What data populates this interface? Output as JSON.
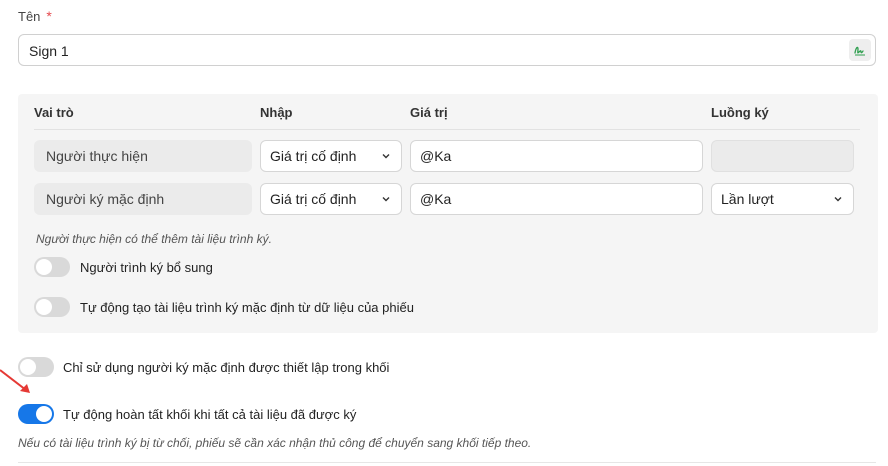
{
  "name_field": {
    "label": "Tên",
    "required_mark": "*",
    "value": "Sign 1"
  },
  "table": {
    "headers": {
      "role": "Vai trò",
      "input": "Nhập",
      "value": "Giá trị",
      "flow": "Luồng ký"
    },
    "rows": [
      {
        "role": "Người thực hiện",
        "input": "Giá trị cố định",
        "value": "@Ka",
        "flow": ""
      },
      {
        "role": "Người ký mặc định",
        "input": "Giá trị cố định",
        "value": "@Ka",
        "flow": "Lần lượt"
      }
    ],
    "note": "Người thực hiện có thể thêm tài liệu trình ký."
  },
  "toggles": {
    "additional_submitter": {
      "label": "Người trình ký bổ sung",
      "on": false
    },
    "auto_create_docs": {
      "label": "Tự động tạo tài liệu trình ký mặc định từ dữ liệu của phiếu",
      "on": false
    },
    "only_default_signers": {
      "label": "Chỉ sử dụng người ký mặc định được thiết lập trong khối",
      "on": false
    },
    "auto_complete_block": {
      "label": "Tự động hoàn tất khối khi tất cả tài liệu đã được ký",
      "on": true
    }
  },
  "footer_note": "Nếu có tài liệu trình ký bị từ chối, phiếu sẽ cần xác nhận thủ công để chuyển sang khối tiếp theo.",
  "colors": {
    "accent": "#1677e8",
    "required": "#e5484d",
    "annotation_arrow": "#e53935",
    "signature_icon": "#2e9e4e"
  }
}
